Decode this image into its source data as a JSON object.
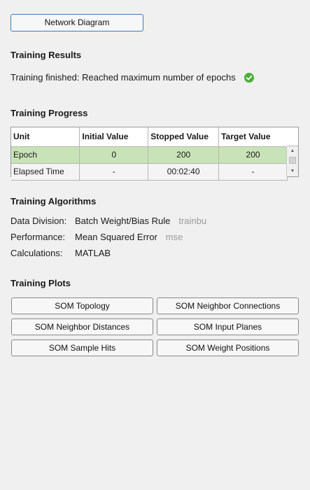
{
  "top_button": {
    "label": "Network Diagram"
  },
  "results": {
    "title": "Training Results",
    "status": "Training finished: Reached maximum number of epochs",
    "status_icon": "check-circle-icon",
    "status_color": "#4caf3a"
  },
  "progress": {
    "title": "Training Progress",
    "columns": [
      "Unit",
      "Initial Value",
      "Stopped Value",
      "Target Value"
    ],
    "rows": [
      {
        "unit": "Epoch",
        "initial": "0",
        "stopped": "200",
        "target": "200"
      },
      {
        "unit": "Elapsed Time",
        "initial": "-",
        "stopped": "00:02:40",
        "target": "-"
      }
    ],
    "selected_row_color": "#c9e3b8"
  },
  "algorithms": {
    "title": "Training Algorithms",
    "items": [
      {
        "label": "Data Division:",
        "value": "Batch Weight/Bias Rule",
        "code": "trainbu"
      },
      {
        "label": "Performance:",
        "value": "Mean Squared Error",
        "code": "mse"
      },
      {
        "label": "Calculations:",
        "value": "MATLAB",
        "code": ""
      }
    ]
  },
  "plots": {
    "title": "Training Plots",
    "buttons": [
      "SOM Topology",
      "SOM Neighbor Connections",
      "SOM Neighbor Distances",
      "SOM Input Planes",
      "SOM Sample Hits",
      "SOM Weight Positions"
    ]
  }
}
